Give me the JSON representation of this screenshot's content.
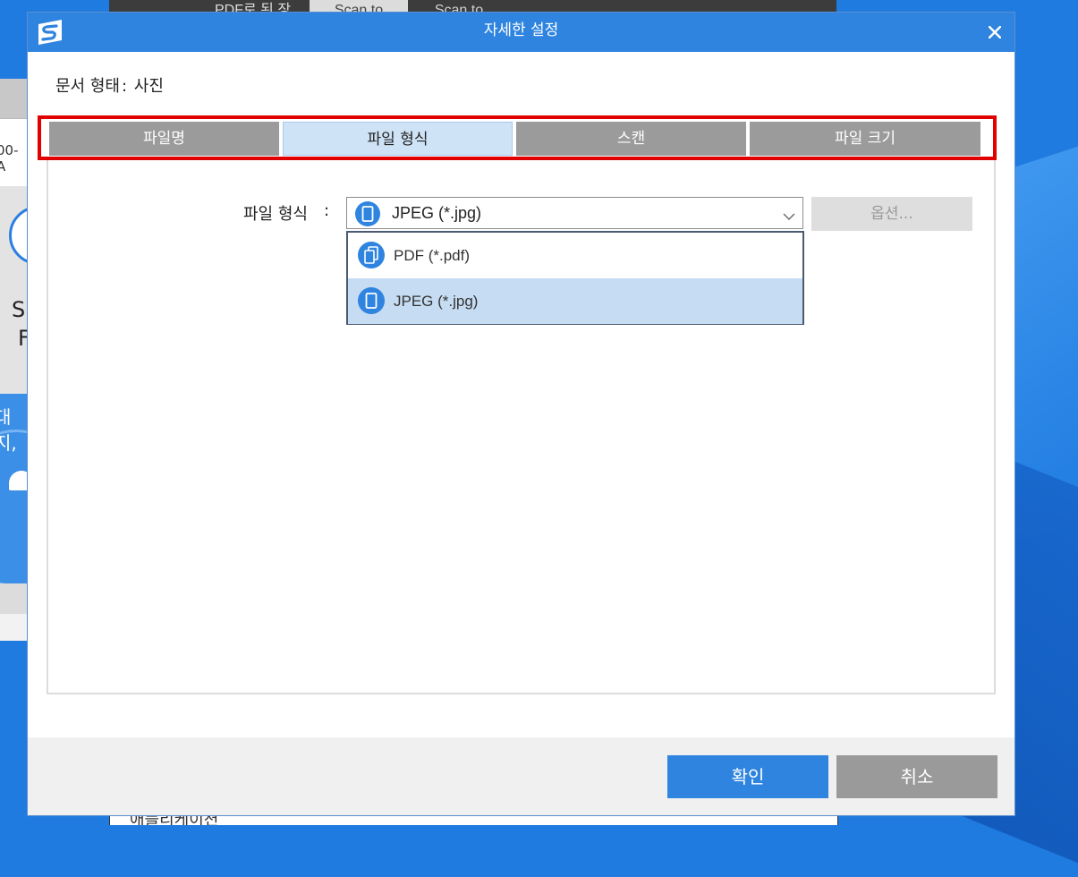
{
  "colors": {
    "titlebar": "#2f84df",
    "highlight": "#e00000",
    "tab_inactive": "#9b9b9b",
    "tab_active": "#cfe3f7",
    "dropdown_selected": "#c5dcf2",
    "ok_button": "#2f84df",
    "cancel_button": "#9a9a9a"
  },
  "background_app": {
    "top_tabs": [
      "PDF로 된 장",
      "Scan to",
      "Scan to"
    ],
    "left_text_fragment": "00-A",
    "left_s": "S",
    "left_f": "F",
    "left_blue_text": "대지,",
    "bottom_text": "애플리케이션"
  },
  "dialog": {
    "app_icon": "scansnap-logo-icon",
    "title": "자세한 설정",
    "close_icon": "close-icon",
    "doc_type_label": "문서 형태",
    "doc_type_value": "사진",
    "tabs": [
      {
        "label": "파일명",
        "active": false
      },
      {
        "label": "파일 형식",
        "active": true
      },
      {
        "label": "스캔",
        "active": false
      },
      {
        "label": "파일 크기",
        "active": false
      }
    ],
    "file_format": {
      "label": "파일 형식",
      "colon": ":",
      "selected": "JPEG (*.jpg)",
      "selected_icon": "jpeg-file-icon",
      "options_button": "옵션...",
      "options_enabled": false
    },
    "dropdown": {
      "options": [
        {
          "label": "PDF (*.pdf)",
          "icon": "pdf-file-icon",
          "selected": false
        },
        {
          "label": "JPEG (*.jpg)",
          "icon": "jpeg-file-icon",
          "selected": true
        }
      ]
    },
    "footer": {
      "ok_label": "확인",
      "cancel_label": "취소"
    }
  }
}
